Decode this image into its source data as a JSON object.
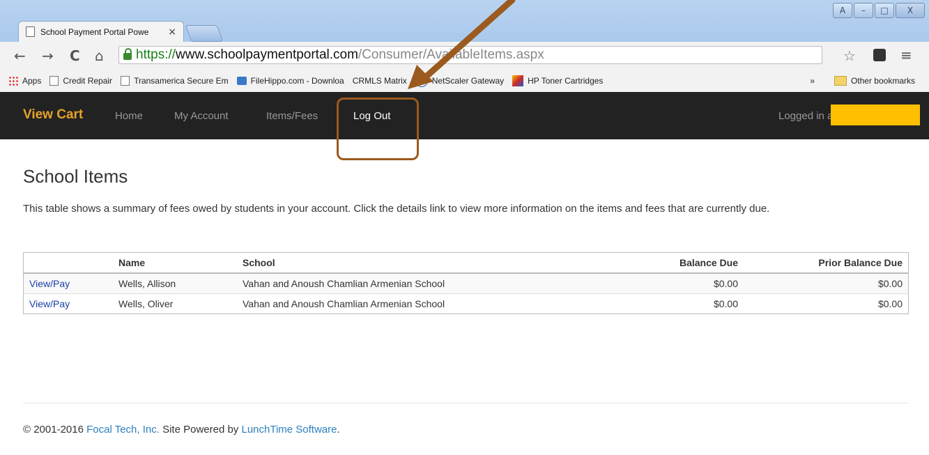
{
  "browser": {
    "tab_title": "School Payment Portal Powe",
    "tab_close": "×",
    "window_controls": [
      "A",
      "–",
      "□",
      "X"
    ],
    "url_scheme": "https://",
    "url_host": "www.schoolpaymentportal.com",
    "url_path": "/Consumer/AvailableItems.aspx",
    "nav": {
      "back": "←",
      "forward": "→",
      "reload": "C",
      "home": "⌂"
    },
    "star": "☆",
    "menu": "≡"
  },
  "bookmarks": {
    "items": [
      "Apps",
      "Credit Repair",
      "Transamerica Secure Em",
      "FileHippo.com - Downloa",
      "CRMLS Matrix",
      "NetScaler Gateway",
      "HP Toner Cartridges"
    ],
    "overflow": "»",
    "other": "Other bookmarks"
  },
  "navbar": {
    "brand": "View Cart",
    "links": [
      "Home",
      "My Account",
      "Items/Fees",
      "Log Out"
    ],
    "logged_in": "Logged in as"
  },
  "page": {
    "title": "School Items",
    "intro": "This table shows a summary of fees owed by students in your account. Click the details link to view more information on the items and fees that are currently due."
  },
  "table": {
    "headers": [
      "",
      "Name",
      "School",
      "Balance Due",
      "Prior Balance Due"
    ],
    "rows": [
      {
        "action": "View/Pay",
        "name": "Wells, Allison",
        "school": "Vahan and Anoush Chamlian Armenian School",
        "balance": "$0.00",
        "prior": "$0.00"
      },
      {
        "action": "View/Pay",
        "name": "Wells, Oliver",
        "school": "Vahan and Anoush Chamlian Armenian School",
        "balance": "$0.00",
        "prior": "$0.00"
      }
    ]
  },
  "footer": {
    "copyright": "© 2001-2016",
    "company": "Focal Tech, Inc.",
    "powered": "Site Powered by",
    "software": "LunchTime Software",
    "period": "."
  },
  "colors": {
    "brand": "#e6a22a",
    "navbar": "#222222",
    "annotation": "#9b5a1e",
    "redaction": "#ffbf00",
    "link": "#1a3fa8"
  }
}
